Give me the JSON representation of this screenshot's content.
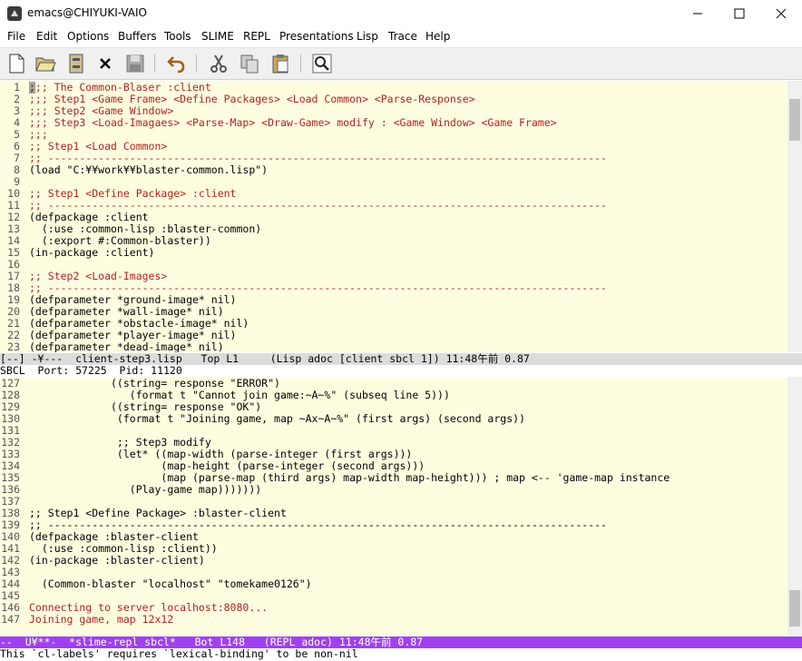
{
  "window": {
    "title": "emacs@CHIYUKI-VAIO"
  },
  "menu": [
    "File",
    "Edit",
    "Options",
    "Buffers",
    "Tools",
    "SLIME",
    "REPL",
    "Presentations",
    "Lisp",
    "Trace",
    "Help"
  ],
  "toolbar": [
    "new-file-icon",
    "open-folder-icon",
    "dired-icon",
    "close-icon",
    "save-icon",
    "undo-icon",
    "cut-icon",
    "copy-icon",
    "paste-icon",
    "search-icon"
  ],
  "top_buffer": {
    "lines": [
      {
        "n": "1",
        "t": ";;; The Common-Blaser :client",
        "c": "red"
      },
      {
        "n": "2",
        "t": ";;; Step1 <Game Frame> <Define Packages> <Load Common> <Parse-Response>",
        "c": "red"
      },
      {
        "n": "3",
        "t": ";;; Step2 <Game Window>",
        "c": "red"
      },
      {
        "n": "4",
        "t": ";;; Step3 <Load-Imagaes> <Parse-Map> <Draw-Game> modify : <Game Window> <Game Frame>",
        "c": "red"
      },
      {
        "n": "5",
        "t": ";;;",
        "c": "red"
      },
      {
        "n": "6",
        "t": ";; Step1 <Load Common>",
        "c": "red"
      },
      {
        "n": "7",
        "t": ";; -----------------------------------------------------------------------------------------",
        "c": "red"
      },
      {
        "n": "8",
        "t": "(load \"C:¥¥work¥¥blaster-common.lisp\")",
        "c": "def"
      },
      {
        "n": "9",
        "t": "",
        "c": "def"
      },
      {
        "n": "10",
        "t": ";; Step1 <Define Package> :client",
        "c": "red"
      },
      {
        "n": "11",
        "t": ";; -----------------------------------------------------------------------------------------",
        "c": "red"
      },
      {
        "n": "12",
        "t": "(defpackage :client",
        "c": "def"
      },
      {
        "n": "13",
        "t": "  (:use :common-lisp :blaster-common)",
        "c": "def"
      },
      {
        "n": "14",
        "t": "  (:export #:Common-blaster))",
        "c": "def"
      },
      {
        "n": "15",
        "t": "(in-package :client)",
        "c": "def"
      },
      {
        "n": "16",
        "t": "",
        "c": "def"
      },
      {
        "n": "17",
        "t": ";; Step2 <Load-Images>",
        "c": "red"
      },
      {
        "n": "18",
        "t": ";; -----------------------------------------------------------------------------------------",
        "c": "red"
      },
      {
        "n": "19",
        "t": "(defparameter *ground-image* nil)",
        "c": "def"
      },
      {
        "n": "20",
        "t": "(defparameter *wall-image* nil)",
        "c": "def"
      },
      {
        "n": "21",
        "t": "(defparameter *obstacle-image* nil)",
        "c": "def"
      },
      {
        "n": "22",
        "t": "(defparameter *player-image* nil)",
        "c": "def"
      },
      {
        "n": "23",
        "t": "(defparameter *dead-image* nil)",
        "c": "def"
      }
    ]
  },
  "modeline_top": "[--] -¥---  client-step3.lisp   Top L1     (Lisp adoc [client sbcl 1]) 11:48午前 0.87",
  "repl_header": "SBCL  Port: 57225  Pid: 11120",
  "bottom_buffer": {
    "lines": [
      {
        "n": "127",
        "t": "             ((string= response \"ERROR\")",
        "c": "def"
      },
      {
        "n": "128",
        "t": "                (format t \"Cannot join game:~A~%\" (subseq line 5)))",
        "c": "def"
      },
      {
        "n": "129",
        "t": "             ((string= response \"OK\")",
        "c": "def"
      },
      {
        "n": "130",
        "t": "              (format t \"Joining game, map ~Ax~A~%\" (first args) (second args))",
        "c": "def"
      },
      {
        "n": "131",
        "t": "",
        "c": "def"
      },
      {
        "n": "132",
        "t": "              ;; Step3 modify",
        "c": "def"
      },
      {
        "n": "133",
        "t": "              (let* ((map-width (parse-integer (first args)))",
        "c": "def"
      },
      {
        "n": "134",
        "t": "                     (map-height (parse-integer (second args)))",
        "c": "def"
      },
      {
        "n": "135",
        "t": "                     (map (parse-map (third args) map-width map-height))) ; map <-- 'game-map instance",
        "c": "def"
      },
      {
        "n": "136",
        "t": "                (Play-game map)))))))",
        "c": "def"
      },
      {
        "n": "137",
        "t": "",
        "c": "def"
      },
      {
        "n": "138",
        "t": ";; Step1 <Define Package> :blaster-client",
        "c": "def"
      },
      {
        "n": "139",
        "t": ";; -----------------------------------------------------------------------------------------",
        "c": "def"
      },
      {
        "n": "140",
        "t": "(defpackage :blaster-client",
        "c": "def"
      },
      {
        "n": "141",
        "t": "  (:use :common-lisp :client))",
        "c": "def"
      },
      {
        "n": "142",
        "t": "(in-package :blaster-client)",
        "c": "def"
      },
      {
        "n": "143",
        "t": "",
        "c": "def"
      },
      {
        "n": "144",
        "t": "  (Common-blaster \"localhost\" \"tomekame0126\")",
        "c": "def"
      },
      {
        "n": "145",
        "t": "",
        "c": "def"
      },
      {
        "n": "146",
        "t": "Connecting to server localhost:8080...",
        "c": "out"
      },
      {
        "n": "147",
        "t": "Joining game, map 12x12",
        "c": "out"
      }
    ]
  },
  "modeline_bottom": "--  U¥**-  *slime-repl sbcl*   Bot L148   (REPL adoc) 11:48午前 0.87",
  "echo_area": "This `cl-labels' requires `lexical-binding' to be non-nil"
}
